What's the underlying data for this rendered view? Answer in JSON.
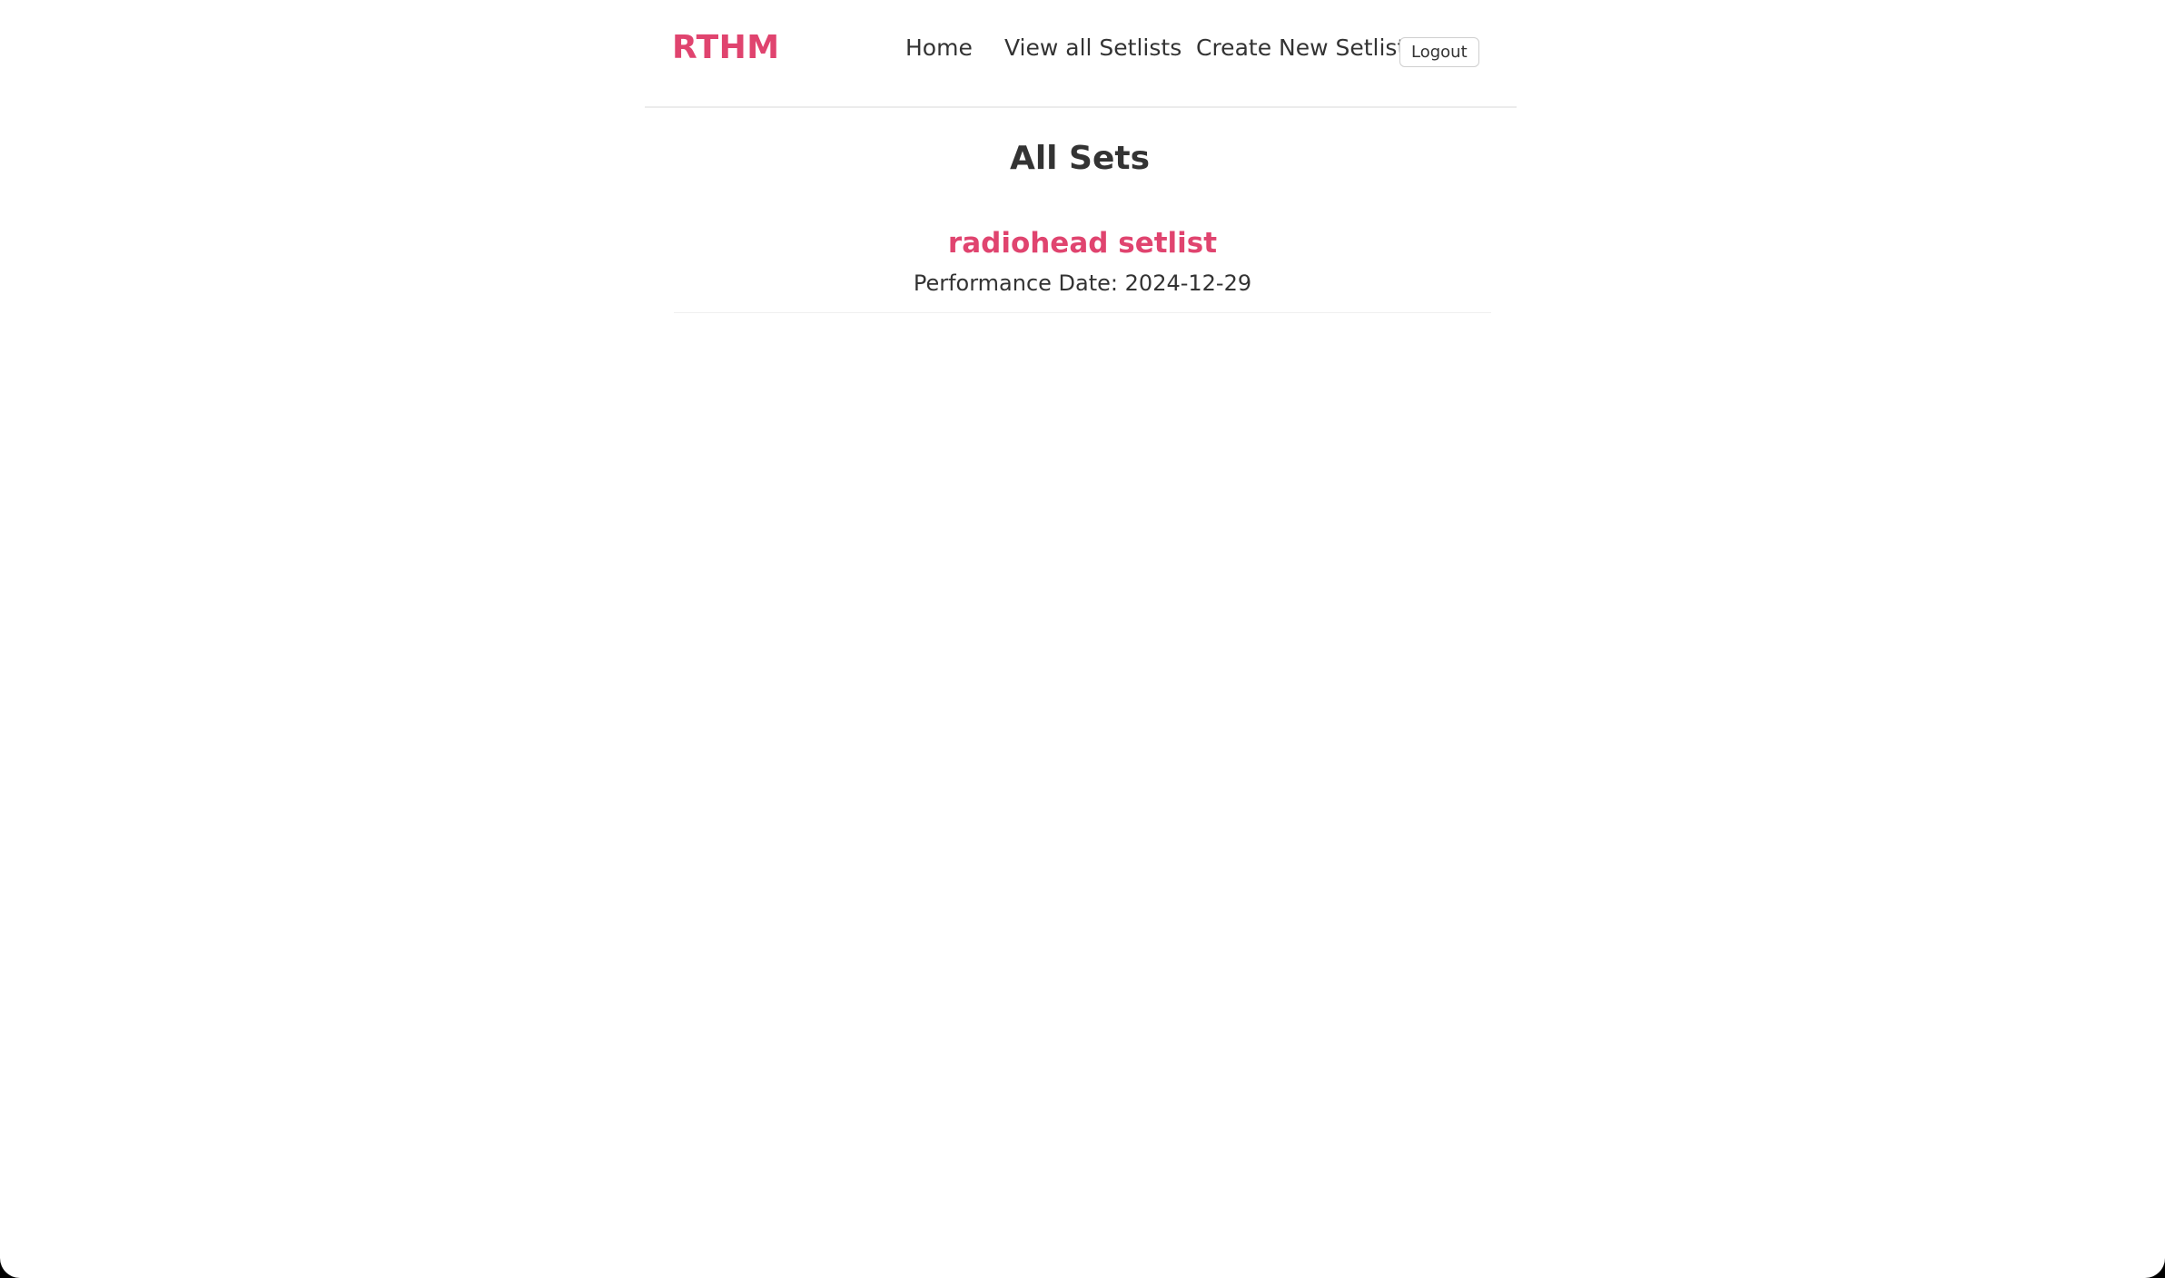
{
  "colors": {
    "accent": "#e0446f",
    "text": "#333333",
    "background": "#ffffff"
  },
  "nav": {
    "brand": "RTHM",
    "links": [
      {
        "label": "Home"
      },
      {
        "label": "View all Setlists"
      },
      {
        "label": "Create New Setlist"
      }
    ],
    "logout_label": "Logout"
  },
  "main": {
    "title": "All Sets",
    "sets": [
      {
        "name": "radiohead setlist",
        "date_label": "Performance Date:",
        "date": "2024-12-29"
      }
    ]
  }
}
